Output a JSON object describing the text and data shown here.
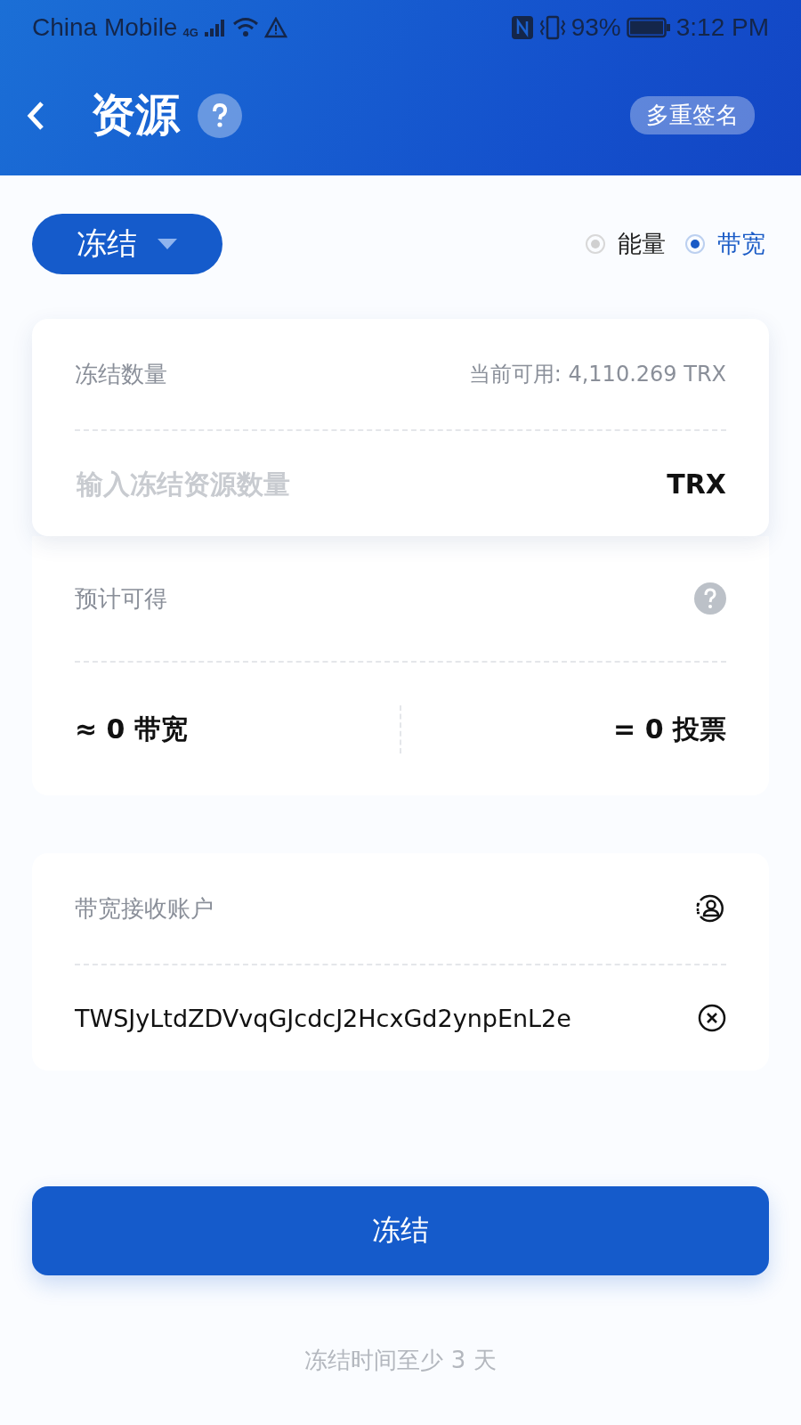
{
  "status_bar": {
    "carrier": "China Mobile",
    "network": "4G",
    "battery": "93%",
    "time": "3:12 PM"
  },
  "header": {
    "title": "资源",
    "multisig": "多重签名"
  },
  "mode_dropdown": {
    "label": "冻结"
  },
  "resource_options": [
    {
      "label": "能量",
      "selected": false
    },
    {
      "label": "带宽",
      "selected": true
    }
  ],
  "amount_card": {
    "label": "冻结数量",
    "available": "当前可用: 4,110.269 TRX",
    "placeholder": "输入冻结资源数量",
    "unit": "TRX"
  },
  "estimate_card": {
    "label": "预计可得",
    "bandwidth": "≈ 0 带宽",
    "votes": "= 0 投票"
  },
  "receiver_card": {
    "label": "带宽接收账户",
    "value": "TWSJyLtdZDVvqGJcdcJ2HcxGd2ynpEnL2e"
  },
  "submit_button": "冻结",
  "note": "冻结时间至少 3 天"
}
